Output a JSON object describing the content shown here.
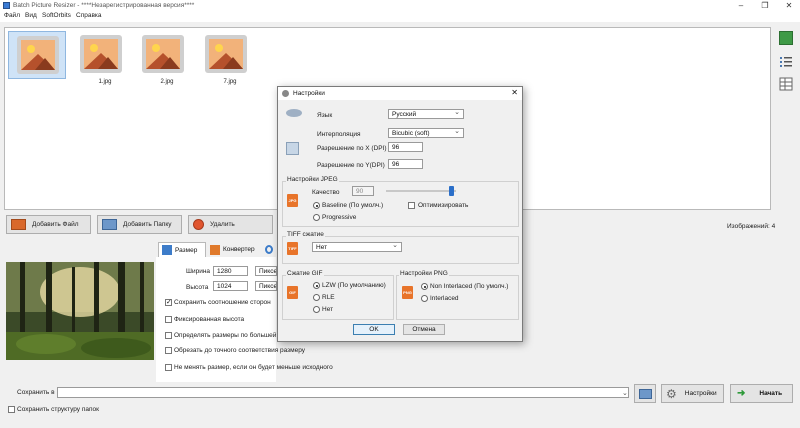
{
  "window": {
    "title": "Batch Picture Resizer - ****Незарегистрированная версия****"
  },
  "menu": [
    "Файл",
    "Вид",
    "SoftOrbits",
    "Справка"
  ],
  "thumbnails": [
    {
      "label": "",
      "selected": true
    },
    {
      "label": "1.jpg",
      "selected": false
    },
    {
      "label": "2.jpg",
      "selected": false
    },
    {
      "label": "7.jpg",
      "selected": false
    }
  ],
  "actions": {
    "add_file": "Добавить Файл",
    "add_folder": "Добавить Папку",
    "delete": "Удалить",
    "images_count": "Изображений: 4"
  },
  "tabs": {
    "size": "Размер",
    "converter": "Конвертер"
  },
  "resize": {
    "width_label": "Ширина",
    "width_value": "1280",
    "height_label": "Высота",
    "height_value": "1024",
    "unit": "Пиксели",
    "keep_ratio": "Сохранить соотношение сторон",
    "fixed_height": "Фиксированная высота",
    "by_larger_side": "Определять размеры по большей стороне",
    "crop_exact": "Обрезать до точного соответствия размеру",
    "no_upscale": "Не менять размер, если он будет меньше исходного"
  },
  "bottom": {
    "save_to_label": "Сохранить в",
    "save_to_value": "",
    "keep_structure": "Сохранить структуру папок",
    "settings_button": "Настройки",
    "start_button": "Начать"
  },
  "dialog": {
    "title": "Настройки",
    "language_label": "Язык",
    "language_value": "Русский",
    "interpolation_label": "Интерполяция",
    "interpolation_value": "Bicubic (soft)",
    "dpi_x_label": "Разрешение по X (DPI)",
    "dpi_x_value": "96",
    "dpi_y_label": "Разрешение по Y(DPI)",
    "dpi_y_value": "96",
    "jpeg_group": "Настройки JPEG",
    "quality_label": "Качество",
    "quality_value": "90",
    "baseline": "Baseline (По умолч.)",
    "progressive": "Progressive",
    "optimize": "Оптимизировать",
    "tiff_group": "TIFF сжатие",
    "tiff_value": "Нет",
    "gif_group": "Сжатие GIF",
    "gif_lzw": "LZW (По умолчанию)",
    "gif_rle": "RLE",
    "gif_none": "Нет",
    "png_group": "Настройки PNG",
    "png_non_interlaced": "Non Interlaced (По умолч.)",
    "png_interlaced": "Interlaced",
    "ok": "OK",
    "cancel": "Отмена",
    "format_icons": {
      "jpeg": "JPG",
      "tiff": "TIFF",
      "gif": "GIF",
      "png": "PNG"
    }
  },
  "colors": {
    "accent": "#3c7fb1",
    "start_green": "#2e9a3a",
    "format_orange": "#e8742a"
  }
}
